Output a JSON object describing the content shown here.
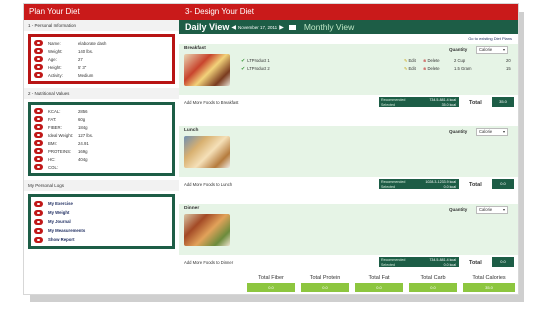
{
  "left": {
    "title": "Plan Your Diet",
    "personal": {
      "heading": "1 - Personal Information",
      "rows": [
        {
          "label": "Name:",
          "value": "elaborate dash"
        },
        {
          "label": "Weight:",
          "value": "140 lbs."
        },
        {
          "label": "Age:",
          "value": "27"
        },
        {
          "label": "Height:",
          "value": "5' 3\""
        },
        {
          "label": "Activity:",
          "value": "Medium"
        }
      ]
    },
    "nutrition": {
      "heading": "2 - Nutritional Values",
      "rows": [
        {
          "label": "KCAL:",
          "value": "2856"
        },
        {
          "label": "FAT:",
          "value": "60g"
        },
        {
          "label": "FIBER:",
          "value": "184g"
        },
        {
          "label": "Ideal Weight:",
          "value": "127 lbs."
        },
        {
          "label": "BMI:",
          "value": "24.91"
        },
        {
          "label": "PROTEINS:",
          "value": "169g"
        },
        {
          "label": "HC:",
          "value": "404g"
        },
        {
          "label": "COL:",
          "value": ""
        }
      ]
    },
    "logs": {
      "heading": "My Personal Logs",
      "items": [
        "My Exercise",
        "My Weight",
        "My Journal",
        "My Measurements",
        "Show Report"
      ]
    }
  },
  "right": {
    "title": "3- Design Your Diet",
    "daily_view": "Daily View",
    "date": "November 17, 2011",
    "monthly_view": "Monthly View",
    "goto": "Go to existing Diet Plans",
    "quantity_label": "Quantity",
    "quantity_select": "Calorie",
    "recommended_label": "Recommended",
    "selected_label": "Selected",
    "total_label": "Total",
    "edit_label": "Edit",
    "delete_label": "Delete",
    "meals": [
      {
        "name": "Breakfast",
        "add_more": "Add More Foods to Breakfast",
        "products": [
          {
            "name": "LTProduct 1",
            "amount": "2 Cup",
            "extra": "20"
          },
          {
            "name": "LTProduct 2",
            "amount": "1.5 Gram",
            "extra": "15"
          }
        ],
        "recommended": "734.5-881.4 kcal",
        "selected": "35.0 kcal",
        "total": "35.0"
      },
      {
        "name": "Lunch",
        "add_more": "Add More Foods to Lunch",
        "products": [],
        "recommended": "1028.3-1233.9 kcal",
        "selected": "0.0 kcal",
        "total": "0.0"
      },
      {
        "name": "Dinner",
        "add_more": "Add More Foods to Dinner",
        "products": [],
        "recommended": "734.5-881.4 kcal",
        "selected": "0.0 kcal",
        "total": "0.0"
      }
    ],
    "totals": [
      {
        "label": "Total Fiber",
        "value": "0.0"
      },
      {
        "label": "Total Protein",
        "value": "0.0"
      },
      {
        "label": "Total Fat",
        "value": "0.0"
      },
      {
        "label": "Total Carb",
        "value": "0.0"
      },
      {
        "label": "Total Calories",
        "value": "35.0"
      }
    ]
  }
}
